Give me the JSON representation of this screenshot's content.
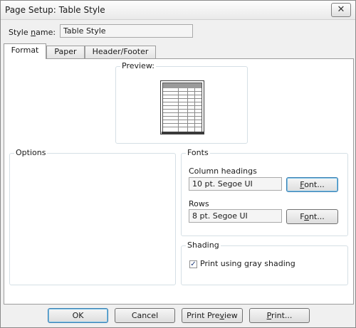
{
  "window": {
    "title": "Page Setup: Table Style",
    "close_glyph": "✕"
  },
  "style_name": {
    "label_pre": "Style ",
    "label_u": "n",
    "label_post": "ame:",
    "value": "Table Style"
  },
  "tabs": [
    {
      "label": "Format",
      "active": true
    },
    {
      "label": "Paper",
      "active": false
    },
    {
      "label": "Header/Footer",
      "active": false
    }
  ],
  "preview": {
    "label": "Preview:",
    "icon": "table-preview-icon"
  },
  "options": {
    "label": "Options"
  },
  "fonts": {
    "label": "Fonts",
    "column_headings": {
      "label": "Column headings",
      "value": "10 pt. Segoe UI",
      "button_pre": "",
      "button_u": "F",
      "button_post": "ont..."
    },
    "rows": {
      "label": "Rows",
      "value": "8 pt. Segoe UI",
      "button_pre": "F",
      "button_u": "o",
      "button_post": "nt..."
    }
  },
  "shading": {
    "label": "Shading",
    "checkbox_checked": true,
    "checkbox_label_pre": "Print using ",
    "checkbox_label_u": "g",
    "checkbox_label_post": "ray shading",
    "check_glyph": "✓"
  },
  "buttons": {
    "ok": "OK",
    "cancel": "Cancel",
    "print_preview_pre": "Print Pre",
    "print_preview_u": "v",
    "print_preview_post": "iew",
    "print_pre": "",
    "print_u": "P",
    "print_post": "rint..."
  }
}
